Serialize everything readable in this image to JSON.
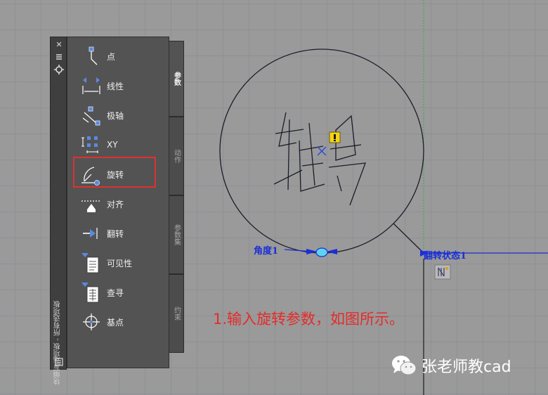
{
  "palette": {
    "title": "块编写选项板 - 所有选项板",
    "strip_icons": [
      "close-icon",
      "autohide-icon",
      "properties-icon",
      "palette-menu-icon"
    ],
    "tools": [
      {
        "name": "point",
        "label": "点",
        "icon": "point-param-icon"
      },
      {
        "name": "linear",
        "label": "线性",
        "icon": "linear-param-icon"
      },
      {
        "name": "polar",
        "label": "极轴",
        "icon": "polar-param-icon"
      },
      {
        "name": "xy",
        "label": "XY",
        "icon": "xy-param-icon"
      },
      {
        "name": "rotation",
        "label": "旋转",
        "icon": "rotation-param-icon"
      },
      {
        "name": "alignment",
        "label": "对齐",
        "icon": "alignment-param-icon"
      },
      {
        "name": "flip",
        "label": "翻转",
        "icon": "flip-param-icon"
      },
      {
        "name": "visibility",
        "label": "可见性",
        "icon": "visibility-param-icon"
      },
      {
        "name": "lookup",
        "label": "查寻",
        "icon": "lookup-param-icon"
      },
      {
        "name": "basepoint",
        "label": "基点",
        "icon": "basepoint-param-icon"
      }
    ],
    "tabs": [
      {
        "label": "参数",
        "active": true
      },
      {
        "label": "动作",
        "active": false
      },
      {
        "label": "参数集",
        "active": false
      },
      {
        "label": "约束",
        "active": false
      }
    ],
    "highlighted_tool": "rotation",
    "highlight_color": "#e03030"
  },
  "drawing": {
    "symbol_text": "轴号",
    "angle_label": "角度1",
    "flip_label": "翻转状态1",
    "warning_icon": "warning-icon",
    "flip_grip_icon": "flip-grip-icon",
    "param_color": "#1a2fd6",
    "line_color": "#1c1c2a"
  },
  "instruction": "1.输入旋转参数，如图所示。",
  "instruction_color": "#e52b2b",
  "watermark": {
    "icon": "wechat-icon",
    "text": "张老师教cad"
  }
}
